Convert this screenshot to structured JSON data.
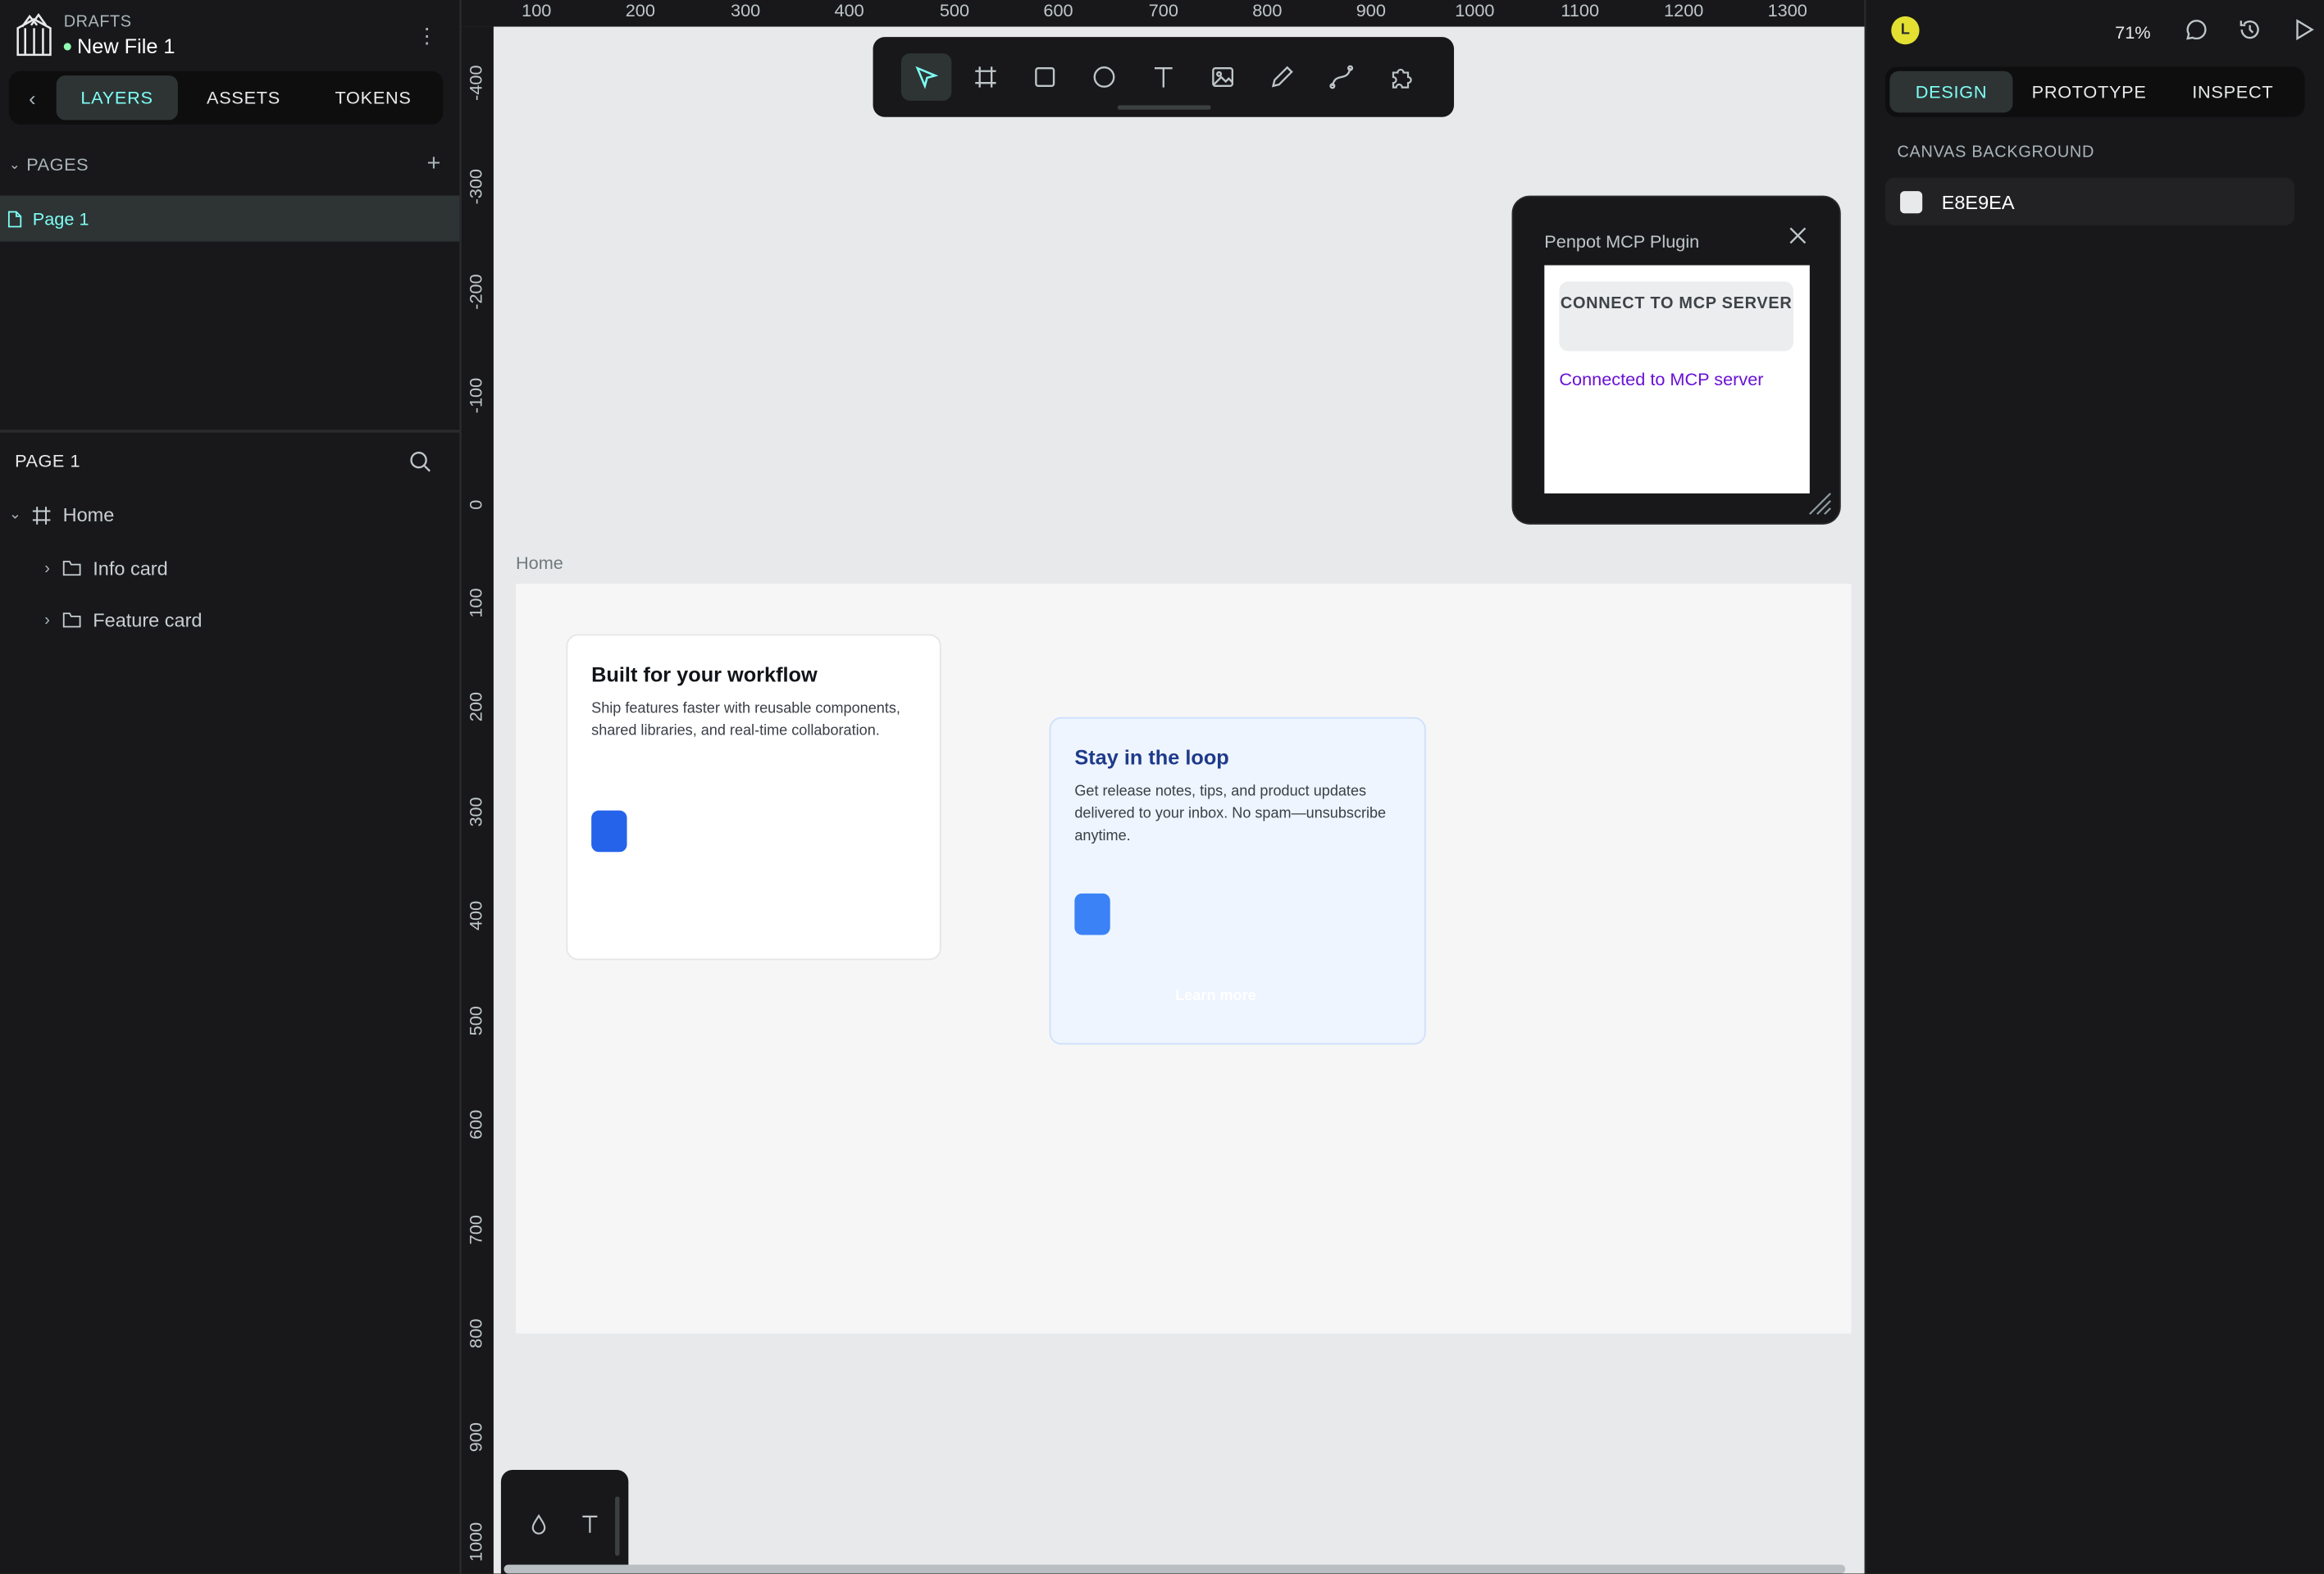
{
  "header": {
    "project": "DRAFTS",
    "file_name": "New File 1"
  },
  "left_tabs": [
    "LAYERS",
    "ASSETS",
    "TOKENS"
  ],
  "pages": {
    "title": "PAGES",
    "items": [
      "Page 1"
    ]
  },
  "layers": {
    "title": "PAGE 1",
    "items": [
      "Home",
      "Info card",
      "Feature card"
    ]
  },
  "ruler_top": [
    "100",
    "200",
    "300",
    "400",
    "500",
    "600",
    "700",
    "800",
    "900",
    "1000",
    "1100",
    "1200",
    "1300"
  ],
  "ruler_left": [
    "-400",
    "-300",
    "-200",
    "-100",
    "0",
    "100",
    "200",
    "300",
    "400",
    "500",
    "600",
    "700",
    "800",
    "900",
    "1000"
  ],
  "board": {
    "label": "Home"
  },
  "card1": {
    "title": "Built for your workflow",
    "body": "Ship features faster with reusable components, shared libraries, and real-time collaboration.",
    "button_color": "#2563eb"
  },
  "card2": {
    "title": "Stay in the loop",
    "body": "Get release notes, tips, and product updates delivered to your inbox. No spam—unsubscribe anytime.",
    "button_color": "#3b82f6",
    "link": "Learn more"
  },
  "plugin": {
    "title": "Penpot MCP Plugin",
    "button": "CONNECT TO MCP SERVER",
    "status": "Connected to MCP server"
  },
  "right": {
    "avatar": "L",
    "zoom": "71%",
    "tabs": [
      "DESIGN",
      "PROTOTYPE",
      "INSPECT"
    ],
    "canvas_bg_title": "CANVAS BACKGROUND",
    "canvas_bg_value": "E8E9EA"
  },
  "colors": {
    "accent": "#7efff5",
    "panel": "#18181a",
    "canvas": "#e8e9ea",
    "status_purple": "#6911d4"
  }
}
